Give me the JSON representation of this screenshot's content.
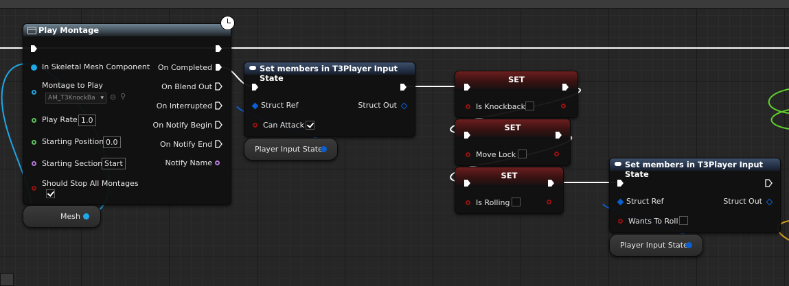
{
  "play_montage": {
    "title": "Play Montage",
    "inputs": {
      "skeletal_mesh": "In Skeletal Mesh Component",
      "montage_to_play": "Montage to Play",
      "montage_value": "AM_T3KnockBa",
      "play_rate": "Play Rate",
      "play_rate_value": "1.0",
      "starting_position": "Starting Position",
      "starting_position_value": "0.0",
      "starting_section": "Starting Section",
      "starting_section_value": "Start",
      "should_stop": "Should Stop All Montages"
    },
    "outputs": {
      "on_completed": "On Completed",
      "on_blend_out": "On Blend Out",
      "on_interrupted": "On Interrupted",
      "on_notify_begin": "On Notify Begin",
      "on_notify_end": "On Notify End",
      "notify_name": "Notify Name"
    }
  },
  "mesh_node": {
    "label": "Mesh"
  },
  "set_members_1": {
    "title": "Set members in T3Player Input State",
    "struct_ref": "Struct Ref",
    "struct_out": "Struct Out",
    "member": "Can Attack",
    "member_checked": true
  },
  "player_input_state_1": {
    "label": "Player Input State"
  },
  "set_knockback": {
    "title": "SET",
    "label": "Is Knockback"
  },
  "set_move_lock": {
    "title": "SET",
    "label": "Move Lock"
  },
  "set_rolling": {
    "title": "SET",
    "label": "Is Rolling"
  },
  "set_members_2": {
    "title": "Set members in T3Player Input State",
    "struct_ref": "Struct Ref",
    "struct_out": "Struct Out",
    "member": "Wants To Roll",
    "member_checked": false
  },
  "player_input_state_2": {
    "label": "Player Input State"
  },
  "colors": {
    "exec": "#ffffff",
    "object_pin": "#1fa7e6",
    "float_pin": "#5ec45e",
    "name_pin": "#b57bdc",
    "bool_pin": "#9b0f0f",
    "struct_pin": "#0b5fd1",
    "green_wire": "#5ed12a",
    "yellow_wire": "#d7a21c"
  }
}
